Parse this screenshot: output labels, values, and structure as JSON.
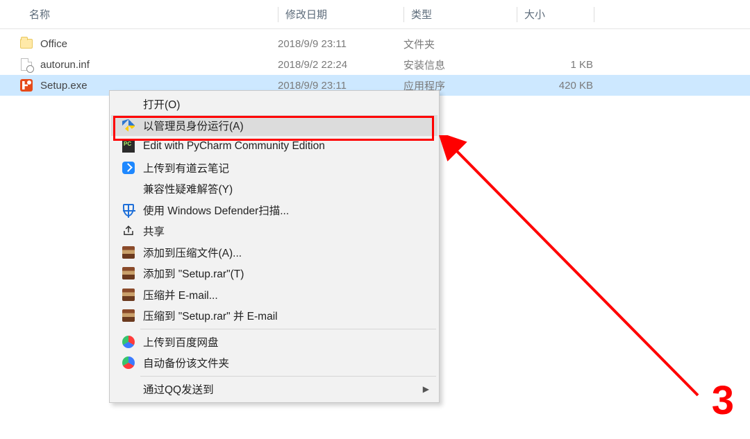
{
  "columns": {
    "name": "名称",
    "date": "修改日期",
    "type": "类型",
    "size": "大小"
  },
  "files": [
    {
      "name": "Office",
      "date": "2018/9/9 23:11",
      "type": "文件夹",
      "size": ""
    },
    {
      "name": "autorun.inf",
      "date": "2018/9/2 22:24",
      "type": "安装信息",
      "size": "1 KB"
    },
    {
      "name": "Setup.exe",
      "date": "2018/9/9 23:11",
      "type": "应用程序",
      "size": "420 KB"
    }
  ],
  "menu": {
    "open": "打开(O)",
    "run_admin": "以管理员身份运行(A)",
    "pycharm": "Edit with PyCharm Community Edition",
    "youdao": "上传到有道云笔记",
    "compat": "兼容性疑难解答(Y)",
    "defender": "使用 Windows Defender扫描...",
    "share": "共享",
    "rar_add": "添加到压缩文件(A)...",
    "rar_addto": "添加到 \"Setup.rar\"(T)",
    "rar_email": "压缩并 E-mail...",
    "rar_email2": "压缩到 \"Setup.rar\" 并 E-mail",
    "baidu": "上传到百度网盘",
    "baidu_auto": "自动备份该文件夹",
    "qq_send": "通过QQ发送到"
  },
  "annotation": {
    "step": "3"
  }
}
